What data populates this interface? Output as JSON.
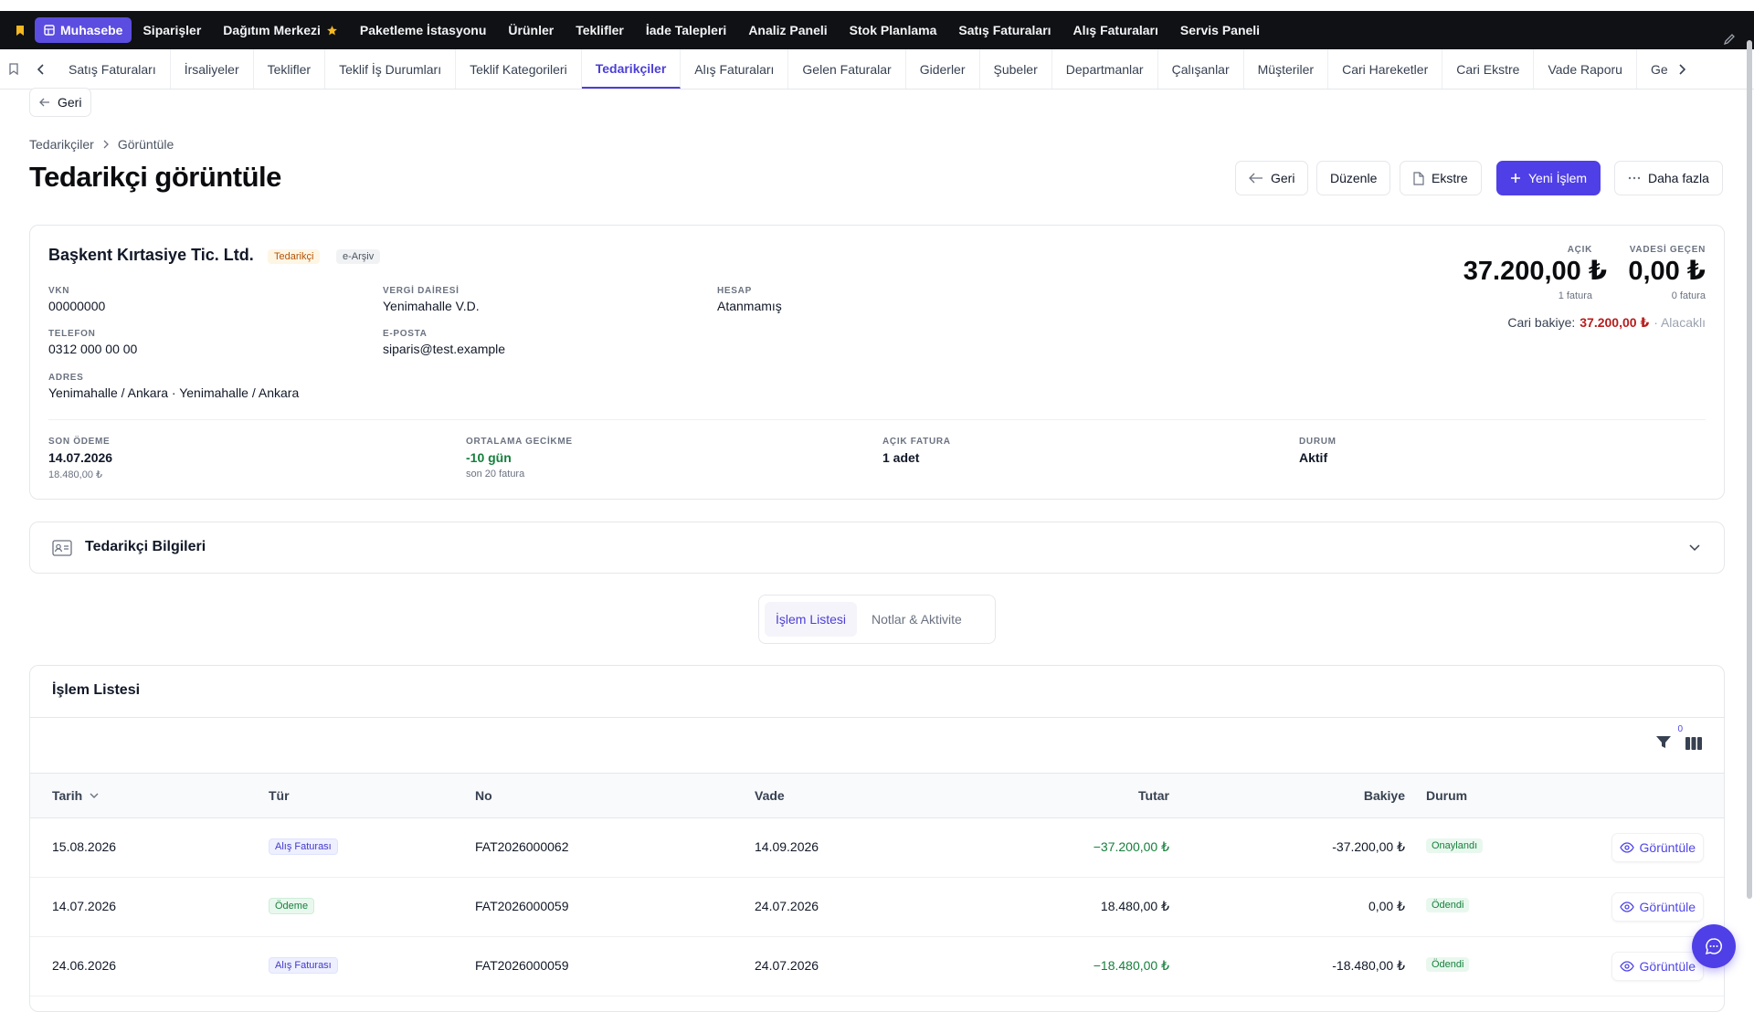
{
  "topnav": {
    "items": [
      "Muhasebe",
      "Siparişler",
      "Dağıtım Merkezi",
      "Paketleme İstasyonu",
      "Ürünler",
      "Teklifler",
      "İade Talepleri",
      "Analiz Paneli",
      "Stok Planlama",
      "Satış Faturaları",
      "Alış Faturaları",
      "Servis Paneli"
    ],
    "active": "Muhasebe",
    "star_on": "Dağıtım Merkezi"
  },
  "tabs": [
    "Satış Faturaları",
    "İrsaliyeler",
    "Teklifler",
    "Teklif İş Durumları",
    "Teklif Kategorileri",
    "Tedarikçiler",
    "Alış Faturaları",
    "Gelen Faturalar",
    "Giderler",
    "Şubeler",
    "Departmanlar",
    "Çalışanlar",
    "Müşteriler",
    "Cari Hareketler",
    "Cari Ekstre",
    "Vade Raporu",
    "Ge"
  ],
  "active_tab": "Tedarikçiler",
  "back_label": "Geri",
  "breadcrumb": {
    "parent": "Tedarikçiler",
    "current": "Görüntüle"
  },
  "page_title": "Tedarikçi görüntüle",
  "actions": {
    "back": "Geri",
    "edit": "Düzenle",
    "statement": "Ekstre",
    "new": "Yeni İşlem",
    "more": "Daha fazla"
  },
  "supplier": {
    "name": "Başkent Kırtasiye Tic. Ltd.",
    "type_badge": "Tedarikçi",
    "einvoice_badge": "e-Arşiv",
    "vkn_label": "VKN",
    "vkn": "00000000",
    "tax_office_label": "VERGİ DAİRESİ",
    "tax_office": "Yenimahalle V.D.",
    "account_label": "HESAP",
    "account": "Atanmamış",
    "phone_label": "TELEFON",
    "phone": "0312 000 00 00",
    "email_label": "E-POSTA",
    "email": "siparis@test.example",
    "address_label": "ADRES",
    "address": "Yenimahalle / Ankara · Yenimahalle / Ankara"
  },
  "summary": {
    "open_label": "AÇIK",
    "open_amount": "37.200,00 ₺",
    "open_count": "1 fatura",
    "overdue_label": "VADESİ GEÇEN",
    "overdue_amount": "0,00 ₺",
    "overdue_count": "0 fatura",
    "balance_prefix": "Cari bakiye:",
    "balance_amount": "37.200,00 ₺",
    "balance_suffix": "· Alacaklı"
  },
  "stats": {
    "last_payment_label": "SON ÖDEME",
    "last_payment_date": "14.07.2026",
    "last_payment_amount": "18.480,00 ₺",
    "avg_delay_label": "ORTALAMA GECİKME",
    "avg_delay": "-10 gün",
    "avg_delay_sub": "son 20 fatura",
    "open_invoice_label": "AÇIK FATURA",
    "open_invoice": "1 adet",
    "status_label": "DURUM",
    "status": "Aktif"
  },
  "info_section": "Tedarikçi Bilgileri",
  "segments": [
    "İşlem Listesi",
    "Notlar & Aktivite"
  ],
  "active_segment": "İşlem Listesi",
  "list_title": "İşlem Listesi",
  "filter_count": "0",
  "table": {
    "headers": {
      "date": "Tarih",
      "type": "Tür",
      "no": "No",
      "due": "Vade",
      "amount": "Tutar",
      "balance": "Bakiye",
      "status": "Durum"
    },
    "view_label": "Görüntüle",
    "rows": [
      {
        "date": "15.08.2026",
        "type": "Alış Faturası",
        "no": "FAT2026000062",
        "due": "14.09.2026",
        "amount": "−37.200,00 ₺",
        "balance": "-37.200,00 ₺",
        "status": "Onaylandı"
      },
      {
        "date": "14.07.2026",
        "type": "Ödeme",
        "no": "FAT2026000059",
        "due": "24.07.2026",
        "amount": "18.480,00 ₺",
        "balance": "0,00 ₺",
        "status": "Ödendi"
      },
      {
        "date": "24.06.2026",
        "type": "Alış Faturası",
        "no": "FAT2026000059",
        "due": "24.07.2026",
        "amount": "−18.480,00 ₺",
        "balance": "-18.480,00 ₺",
        "status": "Ödendi"
      }
    ]
  },
  "colors": {
    "accent": "#4f3fe6",
    "negative": "#b91c1c",
    "positive": "#16803c",
    "warning_badge": "#b45309"
  }
}
